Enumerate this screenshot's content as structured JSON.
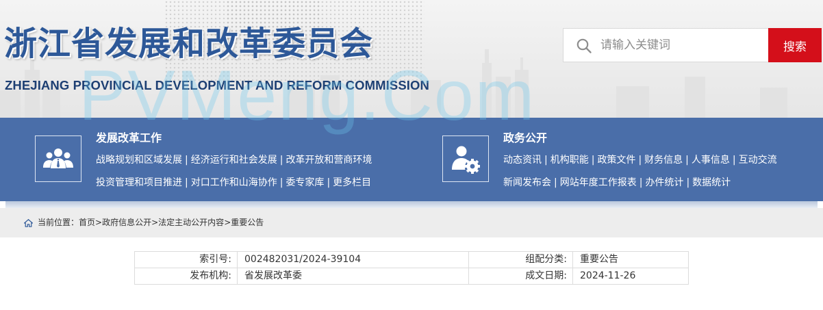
{
  "header": {
    "title_cn": "浙江省发展和改革委员会",
    "title_en": "ZHEJIANG PROVINCIAL DEVELOPMENT AND REFORM COMMISSION",
    "watermark": "PVMeng.Com",
    "search": {
      "placeholder": "请输入关键词",
      "button_label": "搜索",
      "icon": "search-icon"
    }
  },
  "nav": {
    "sections": [
      {
        "heading": "发展改革工作",
        "icon": "people-group-icon",
        "rows": [
          [
            "战略规划和区域发展",
            "经济运行和社会发展",
            "改革开放和营商环境"
          ],
          [
            "投资管理和项目推进",
            "对口工作和山海协作",
            "委专家库",
            "更多栏目"
          ]
        ]
      },
      {
        "heading": "政务公开",
        "icon": "user-gear-icon",
        "rows": [
          [
            "动态资讯",
            "机构职能",
            "政策文件",
            "财务信息",
            "人事信息",
            "互动交流"
          ],
          [
            "新闻发布会",
            "网站年度工作报表",
            "办件统计",
            "数据统计"
          ]
        ]
      }
    ],
    "separator": "|"
  },
  "breadcrumb": {
    "prefix": "当前位置：",
    "items": [
      "首页",
      "政府信息公开",
      "法定主动公开内容",
      "重要公告"
    ],
    "separator": ">"
  },
  "info_table": {
    "rows": [
      [
        {
          "label": "索引号:",
          "value": "002482031/2024-39104"
        },
        {
          "label": "组配分类:",
          "value": "重要公告"
        }
      ],
      [
        {
          "label": "发布机构:",
          "value": "省发展改革委"
        },
        {
          "label": "成文日期:",
          "value": "2024-11-26"
        }
      ]
    ]
  },
  "colors": {
    "brand_blue": "#4a6ea9",
    "title_blue": "#2d5898",
    "search_red": "#d40f1a"
  }
}
